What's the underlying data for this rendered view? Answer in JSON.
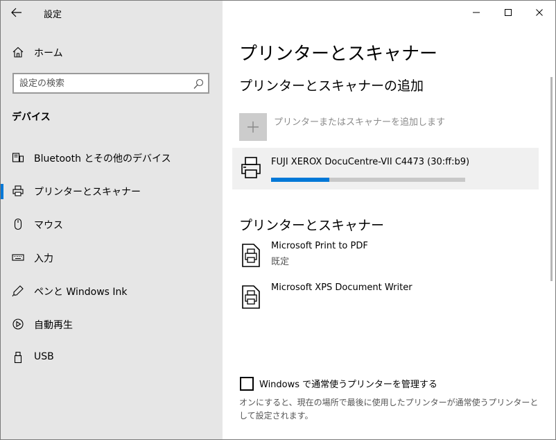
{
  "window": {
    "title": "設定",
    "caption_buttons": [
      "minimize",
      "maximize",
      "close"
    ]
  },
  "sidebar": {
    "home_label": "ホーム",
    "search": {
      "placeholder": "設定の検索",
      "value": ""
    },
    "section_heading": "デバイス",
    "items": [
      {
        "label": "Bluetooth とその他のデバイス",
        "icon": "bluetooth-devices-icon",
        "selected": false
      },
      {
        "label": "プリンターとスキャナー",
        "icon": "printer-icon",
        "selected": true
      },
      {
        "label": "マウス",
        "icon": "mouse-icon",
        "selected": false
      },
      {
        "label": "入力",
        "icon": "keyboard-icon",
        "selected": false
      },
      {
        "label": "ペンと Windows Ink",
        "icon": "pen-icon",
        "selected": false
      },
      {
        "label": "自動再生",
        "icon": "autoplay-icon",
        "selected": false
      },
      {
        "label": "USB",
        "icon": "usb-icon",
        "selected": false
      }
    ]
  },
  "main": {
    "page_title": "プリンターとスキャナー",
    "add_section": {
      "heading": "プリンターとスキャナーの追加",
      "add_button_label": "プリンターまたはスキャナーを追加します",
      "found_device": {
        "name": "FUJI XEROX DocuCentre-VII C4473 (30:ff:b9)",
        "progress": 0.3
      }
    },
    "printers_section": {
      "heading": "プリンターとスキャナー",
      "printers": [
        {
          "name": "Microsoft Print to PDF",
          "status": "既定"
        },
        {
          "name": "Microsoft XPS Document Writer",
          "status": ""
        }
      ]
    },
    "manage_default": {
      "checkbox_label": "Windows で通常使うプリンターを管理する",
      "checked": false,
      "help_text": "オンにすると、現在の場所で最後に使用したプリンターが通常使うプリンターとして設定されます。"
    }
  },
  "colors": {
    "accent": "#0078d7",
    "sidebar_bg": "#e6e6e6",
    "card_bg": "#f0f0f0",
    "disabled_text": "#8a8a8a"
  }
}
